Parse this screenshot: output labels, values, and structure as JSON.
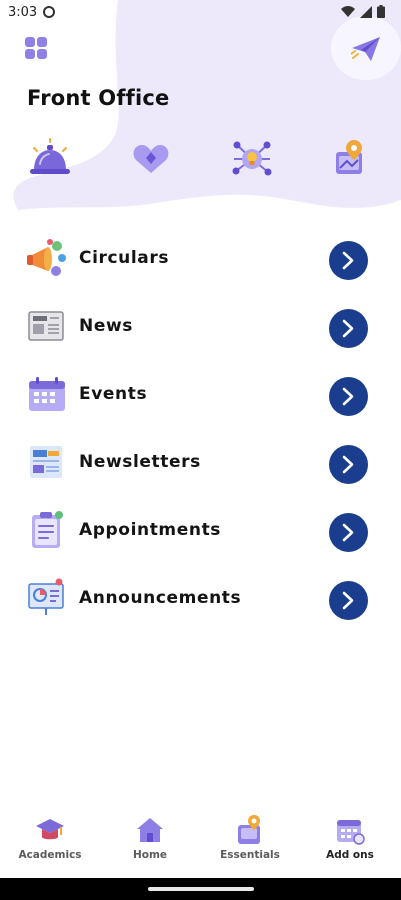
{
  "status_bar": {
    "time": "3:03"
  },
  "header": {
    "title": "Front Office"
  },
  "quick_actions": [
    {
      "icon": "service-bell-icon"
    },
    {
      "icon": "heart-badge-icon"
    },
    {
      "icon": "idea-network-icon"
    },
    {
      "icon": "location-map-icon"
    }
  ],
  "menu": {
    "items": [
      {
        "label": "Circulars",
        "icon": "megaphone-icon"
      },
      {
        "label": "News",
        "icon": "newspaper-icon"
      },
      {
        "label": "Events",
        "icon": "calendar-icon"
      },
      {
        "label": "Newsletters",
        "icon": "newsletter-icon"
      },
      {
        "label": "Appointments",
        "icon": "clipboard-icon"
      },
      {
        "label": "Announcements",
        "icon": "presentation-icon"
      }
    ]
  },
  "bottom_nav": {
    "items": [
      {
        "label": "Academics",
        "icon": "graduation-cap-icon",
        "active": false
      },
      {
        "label": "Home",
        "icon": "home-icon",
        "active": false
      },
      {
        "label": "Essentials",
        "icon": "essentials-icon",
        "active": false
      },
      {
        "label": "Add ons",
        "icon": "calendar-addons-icon",
        "active": true
      }
    ]
  },
  "colors": {
    "accent": "#1a3e8d",
    "blob": "#ede9fb",
    "icon_purple": "#7b6bd8"
  }
}
